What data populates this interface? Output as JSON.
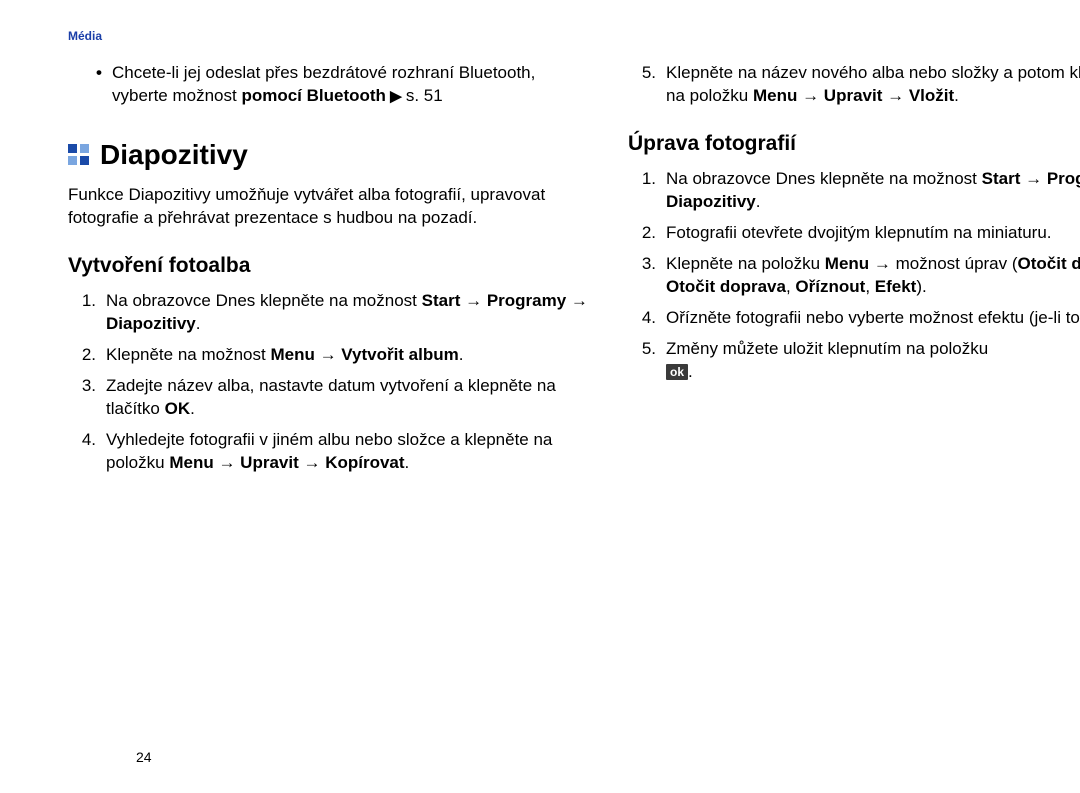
{
  "header": "Média",
  "left": {
    "bullet": {
      "pre": "Chcete-li jej odeslat přes bezdrátové rozhraní Bluetooth, vyberte možnost ",
      "bold1": "pomocí Bluetooth",
      "tri": " ▶ ",
      "tail": "s. 51"
    },
    "section_title": "Diapozitivy",
    "section_desc": "Funkce Diapozitivy umožňuje vytvářet alba fotografií, upravovat fotografie a přehrávat prezentace s hudbou na pozadí.",
    "sub_heading": "Vytvoření fotoalba",
    "steps": [
      {
        "num": "1.",
        "t1": "Na obrazovce Dnes klepněte na možnost ",
        "b1": "Start",
        "a1": " → ",
        "b2": "Programy",
        "a2": " → ",
        "b3": "Diapozitivy",
        "t2": "."
      },
      {
        "num": "2.",
        "t1": "Klepněte na možnost ",
        "b1": "Menu",
        "a1": " → ",
        "b2": "Vytvořit album",
        "t2": "."
      },
      {
        "num": "3.",
        "t1": "Zadejte název alba, nastavte datum vytvoření a klepněte na tlačítko ",
        "b1": "OK",
        "t2": "."
      },
      {
        "num": "4.",
        "t1": "Vyhledejte fotografii v jiném albu nebo složce a klepněte na položku ",
        "b1": "Menu",
        "a1": " → ",
        "b2": "Upravit",
        "a2": " → ",
        "b3": "Kopírovat",
        "t2": "."
      }
    ]
  },
  "right": {
    "top_step": {
      "num": "5.",
      "t1": "Klepněte na název nového alba nebo složky a potom klepněte na položku ",
      "b1": "Menu",
      "a1": " → ",
      "b2": "Upravit",
      "a2": " → ",
      "b3": "Vložit",
      "t2": "."
    },
    "sub_heading": "Úprava fotografií",
    "steps": [
      {
        "num": "1.",
        "t1": "Na obrazovce Dnes klepněte na možnost ",
        "b1": "Start",
        "a1": " → ",
        "b2": "Programy",
        "a2": " → ",
        "b3": "Diapozitivy",
        "t2": "."
      },
      {
        "num": "2.",
        "t1": "Fotografii otevřete dvojitým klepnutím na miniaturu."
      },
      {
        "num": "3.",
        "t1": "Klepněte na položku ",
        "b1": "Menu",
        "a1": " → ",
        "t2": "možnost úprav (",
        "b2": "Otočit doleva",
        "c1": ", ",
        "b3": "Otočit doprava",
        "c2": ", ",
        "b4": "Oříznout",
        "c3": ", ",
        "b5": "Efekt",
        "t3": ")."
      },
      {
        "num": "4.",
        "t1": "Ořízněte fotografii nebo vyberte možnost efektu (je-li to nutné)."
      },
      {
        "num": "5.",
        "t1": "Změny můžete uložit klepnutím na položku ",
        "ok": "ok",
        "t2": "."
      }
    ]
  },
  "page_number": "24"
}
